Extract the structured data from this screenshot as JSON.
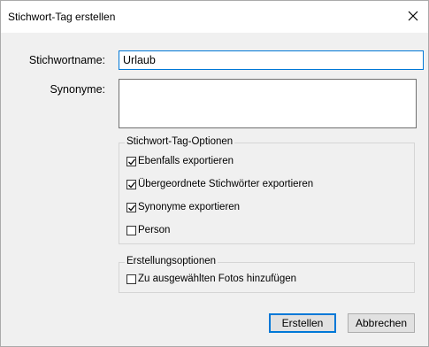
{
  "dialog": {
    "title": "Stichwort-Tag erstellen",
    "close_icon": "close-icon"
  },
  "fields": {
    "name_label": "Stichwortname:",
    "name_value": "Urlaub",
    "synonyms_label": "Synonyme:",
    "synonyms_value": ""
  },
  "tag_options": {
    "title": "Stichwort-Tag-Optionen",
    "items": [
      {
        "label": "Ebenfalls exportieren",
        "checked": true
      },
      {
        "label": "Übergeordnete Stichwörter exportieren",
        "checked": true
      },
      {
        "label": "Synonyme exportieren",
        "checked": true
      },
      {
        "label": "Person",
        "checked": false
      }
    ]
  },
  "create_options": {
    "title": "Erstellungsoptionen",
    "items": [
      {
        "label": "Zu ausgewählten Fotos hinzufügen",
        "checked": false
      }
    ]
  },
  "buttons": {
    "create": "Erstellen",
    "cancel": "Abbrechen"
  },
  "colors": {
    "accent": "#0078d7",
    "dialog_bg": "#f0f0f0"
  }
}
